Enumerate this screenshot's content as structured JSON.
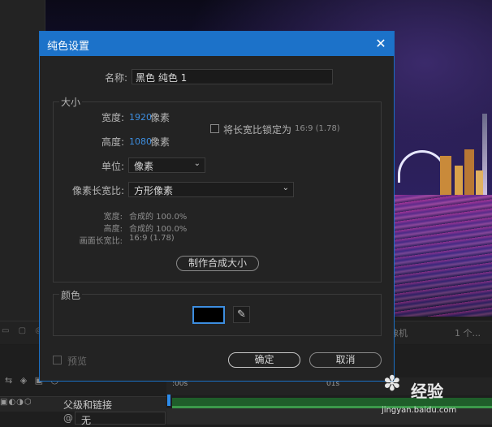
{
  "dialog": {
    "title": "纯色设置",
    "name_label": "名称:",
    "name_value": "黑色 纯色 1",
    "size_group": "大小",
    "width_label": "宽度:",
    "width_value": "1920",
    "width_unit": "像素",
    "height_label": "高度:",
    "height_value": "1080",
    "height_unit": "像素",
    "lock_aspect_label": "将长宽比锁定为",
    "lock_aspect_ratio": "16:9 (1.78)",
    "unit_label": "单位:",
    "unit_value": "像素",
    "pixel_aspect_label": "像素长宽比:",
    "pixel_aspect_value": "方形像素",
    "info_width_label": "宽度:",
    "info_width_value": "合成的 100.0%",
    "info_height_label": "高度:",
    "info_height_value": "合成的 100.0%",
    "info_frame_label": "画面长宽比:",
    "info_frame_value": "16:9 (1.78)",
    "make_comp_size_button": "制作合成大小",
    "color_group": "颜色",
    "swatch_color": "#000000",
    "preview_label": "预览",
    "ok_button": "确定",
    "cancel_button": "取消"
  },
  "background": {
    "strip_right_1": "像机",
    "strip_right_2": "1 个...",
    "timeline_col_label": "父级和链接",
    "timeline_none": "无",
    "ruler_label_1": ":00s",
    "ruler_label_2": "01s"
  },
  "watermark": {
    "text": "经验",
    "url": "jingyan.baidu.com"
  },
  "colors": {
    "accent": "#1c72c9",
    "link_blue": "#3d8ee0"
  }
}
